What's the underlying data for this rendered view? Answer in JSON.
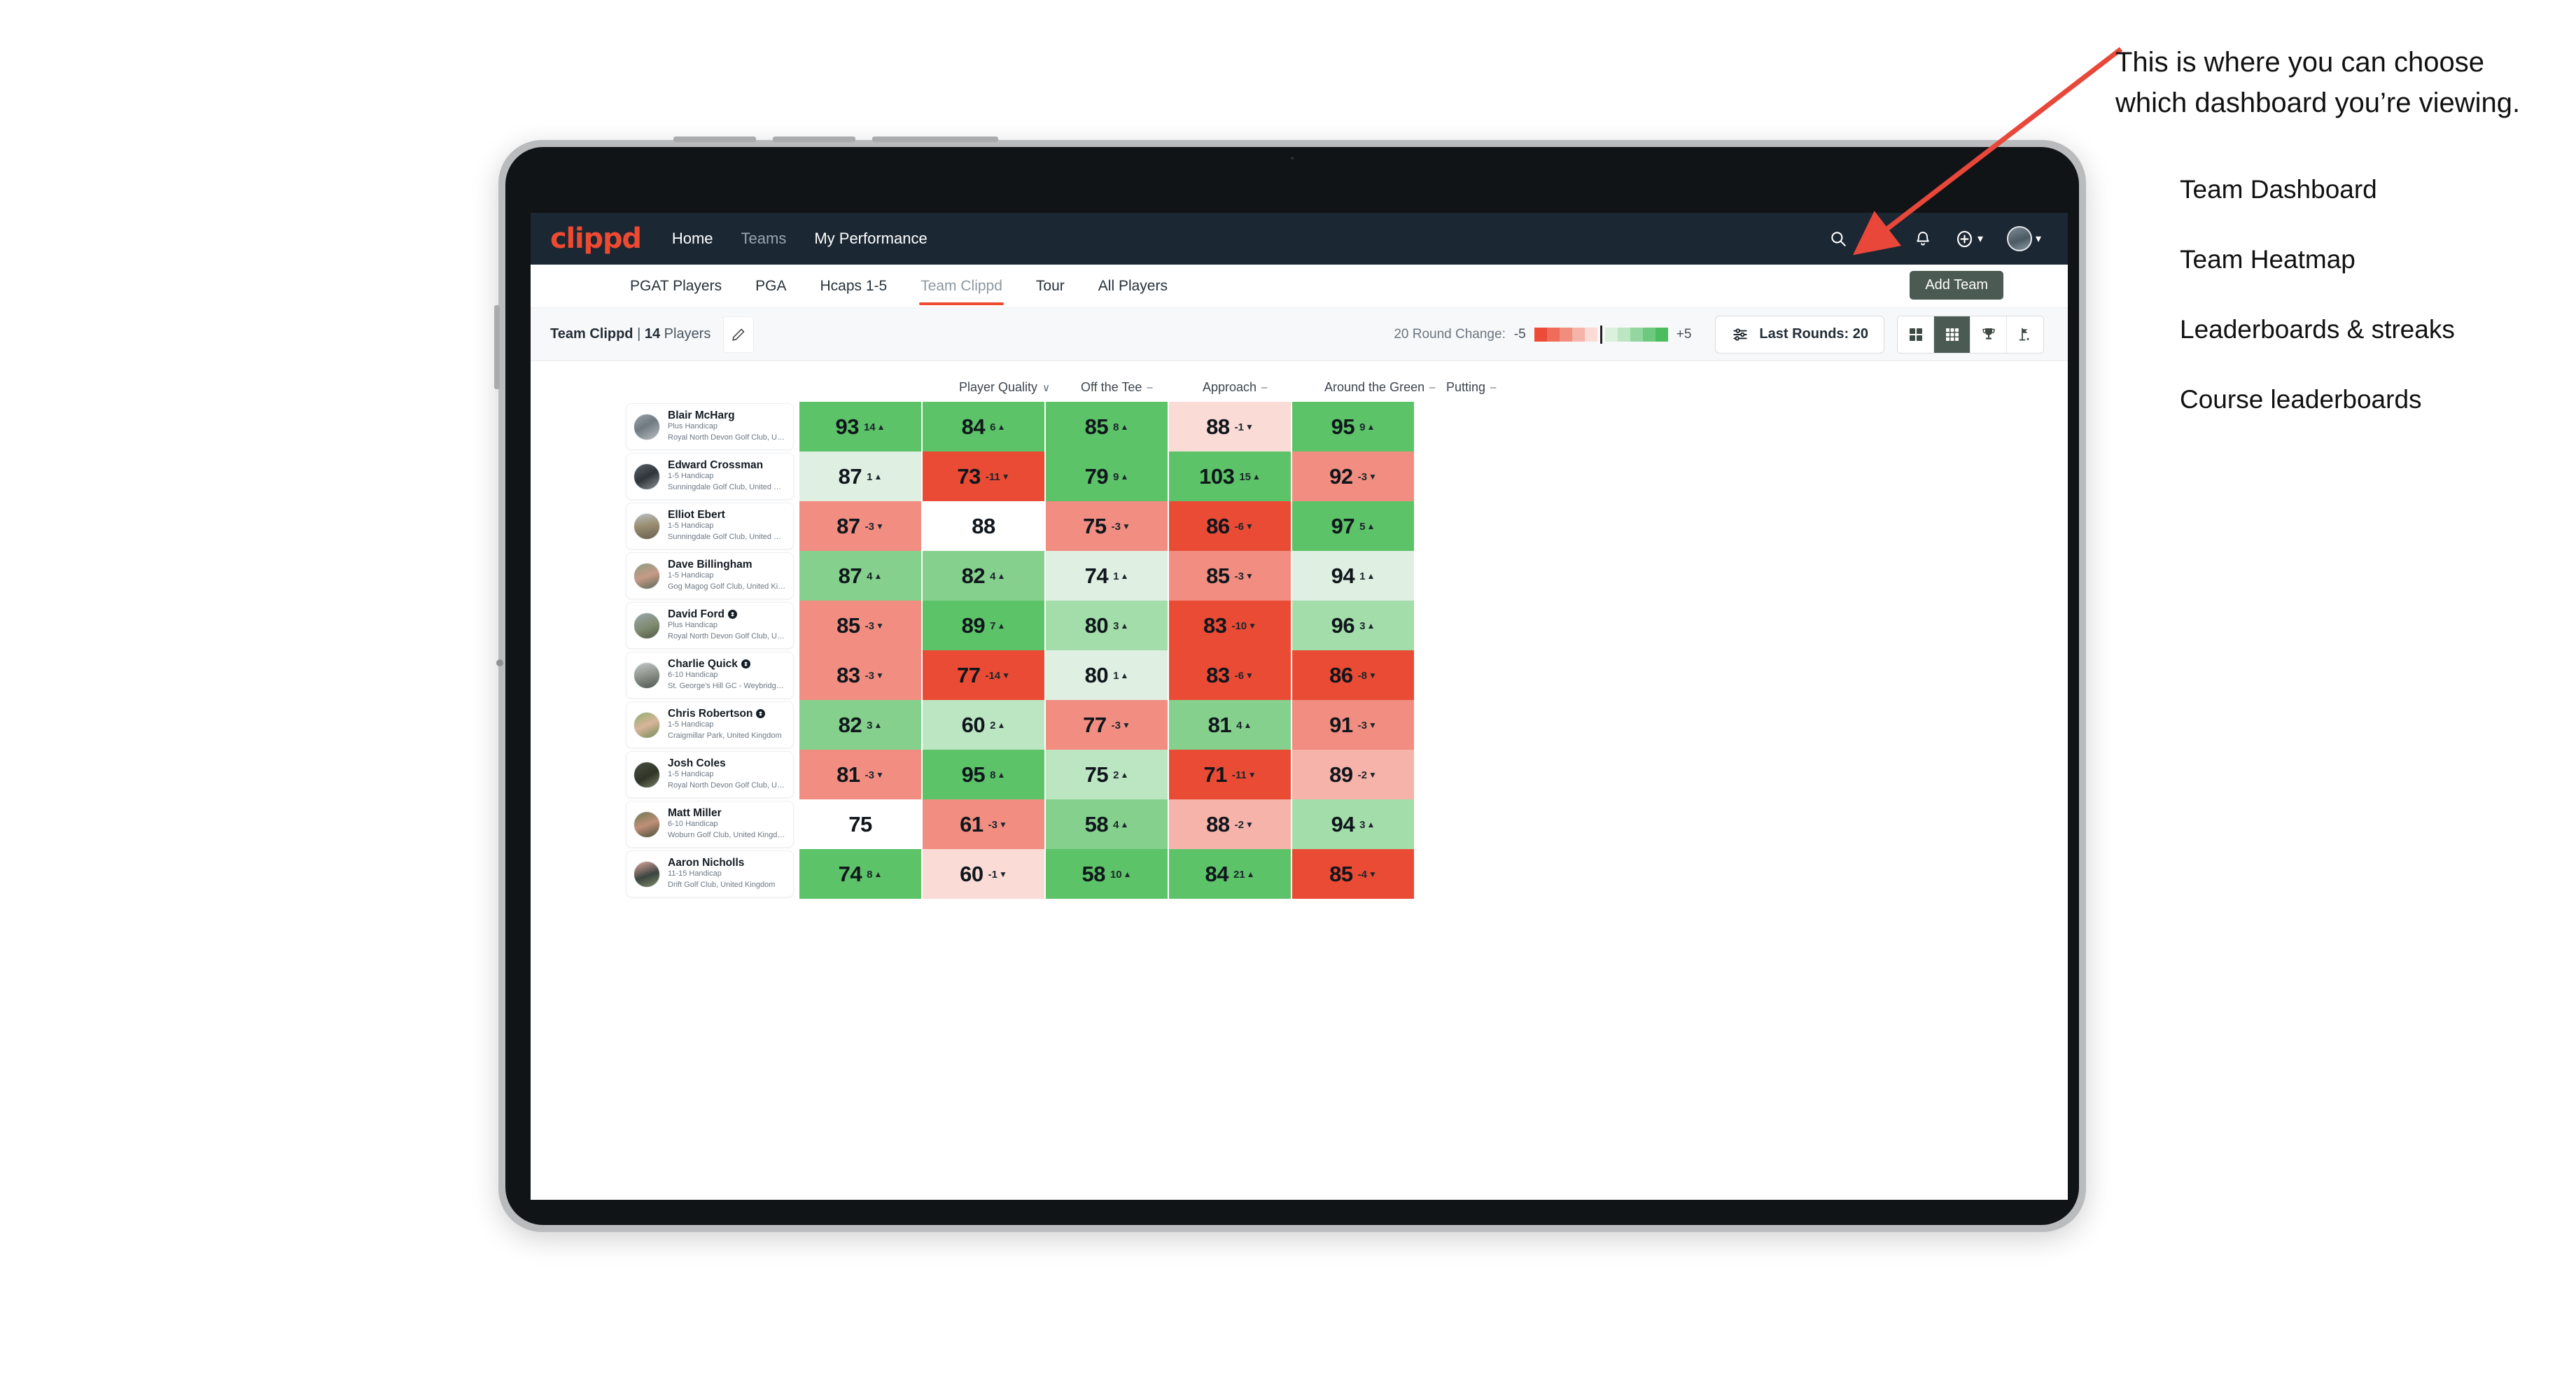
{
  "brand": {
    "logo_text": "clippd",
    "accent": "#ee4a31",
    "nav_bg": "#1b2733"
  },
  "topnav": {
    "links": [
      {
        "label": "Home",
        "active": true
      },
      {
        "label": "Teams",
        "active": false
      },
      {
        "label": "My Performance",
        "active": true
      }
    ],
    "icons": [
      "search-icon",
      "people-icon",
      "bell-icon",
      "plus-circle-icon",
      "avatar"
    ]
  },
  "subtabs": {
    "items": [
      {
        "label": "PGAT Players",
        "active": false
      },
      {
        "label": "PGA",
        "active": false
      },
      {
        "label": "Hcaps 1-5",
        "active": false
      },
      {
        "label": "Team Clippd",
        "active": true
      },
      {
        "label": "Tour",
        "active": false
      },
      {
        "label": "All Players",
        "active": false
      }
    ],
    "add_team_label": "Add Team"
  },
  "controls": {
    "team_name": "Team Clippd",
    "team_separator": " | ",
    "player_count": "14",
    "players_word": "Players",
    "edit_icon": "pencil-icon",
    "legend_title": "20 Round Change:",
    "legend_min": "-5",
    "legend_max": "+5",
    "legend_colors": [
      "#ec4b37",
      "#ef6c5a",
      "#f28c7d",
      "#f6b3aa",
      "#fadbd6",
      "#dcf0de",
      "#bce5c2",
      "#93d6a0",
      "#6dc97e",
      "#4cbd5f"
    ],
    "rounds_label": "Last Rounds: 20",
    "rounds_icon": "filter-sliders-icon",
    "view_toggles": [
      {
        "name": "team-dashboard",
        "icon": "four-squares-icon",
        "active": false
      },
      {
        "name": "team-heatmap",
        "icon": "grid-nine-icon",
        "active": true
      },
      {
        "name": "leaderboards-streaks",
        "icon": "trophy-icon",
        "active": false
      },
      {
        "name": "course-leaderboards",
        "icon": "golf-flag-icon",
        "active": false
      }
    ]
  },
  "table": {
    "columns": [
      {
        "label": "Player Quality",
        "marker": "∨"
      },
      {
        "label": "Off the Tee",
        "marker": "–"
      },
      {
        "label": "Approach",
        "marker": "–"
      },
      {
        "label": "Around the Green",
        "marker": "–"
      },
      {
        "label": "Putting",
        "marker": "–"
      }
    ],
    "rows": [
      {
        "name": "Blair McHarg",
        "verified": false,
        "handicap": "Plus Handicap",
        "club": "Royal North Devon Golf Club, United Kingdom",
        "photo": "linear-gradient(150deg,#9aa3a8 0%,#6f7a80 45%,#b9bfc3 100%)",
        "cells": [
          {
            "value": "93",
            "delta": "14",
            "dir": "up",
            "bg": "#5cc368"
          },
          {
            "value": "84",
            "delta": "6",
            "dir": "up",
            "bg": "#5cc368"
          },
          {
            "value": "85",
            "delta": "8",
            "dir": "up",
            "bg": "#5cc368"
          },
          {
            "value": "88",
            "delta": "-1",
            "dir": "down",
            "bg": "#fadbd6"
          },
          {
            "value": "95",
            "delta": "9",
            "dir": "up",
            "bg": "#5cc368"
          }
        ]
      },
      {
        "name": "Edward Crossman",
        "verified": false,
        "handicap": "1-5 Handicap",
        "club": "Sunningdale Golf Club, United Kingdom",
        "photo": "linear-gradient(150deg,#5c646a 0%,#2f3438 50%,#8d9498 100%)",
        "cells": [
          {
            "value": "87",
            "delta": "1",
            "dir": "up",
            "bg": "#dff0e2"
          },
          {
            "value": "73",
            "delta": "-11",
            "dir": "down",
            "bg": "#ea4b35"
          },
          {
            "value": "79",
            "delta": "9",
            "dir": "up",
            "bg": "#5cc368"
          },
          {
            "value": "103",
            "delta": "15",
            "dir": "up",
            "bg": "#5cc368"
          },
          {
            "value": "92",
            "delta": "-3",
            "dir": "down",
            "bg": "#f18e81"
          }
        ]
      },
      {
        "name": "Elliot Ebert",
        "verified": false,
        "handicap": "1-5 Handicap",
        "club": "Sunningdale Golf Club, United Kingdom",
        "photo": "linear-gradient(170deg,#b9bec2 0%,#9a8f72 45%,#6a6150 100%)",
        "cells": [
          {
            "value": "87",
            "delta": "-3",
            "dir": "down",
            "bg": "#f18e81"
          },
          {
            "value": "88",
            "delta": "",
            "dir": "",
            "bg": "#ffffff"
          },
          {
            "value": "75",
            "delta": "-3",
            "dir": "down",
            "bg": "#f18e81"
          },
          {
            "value": "86",
            "delta": "-6",
            "dir": "down",
            "bg": "#ea4b35"
          },
          {
            "value": "97",
            "delta": "5",
            "dir": "up",
            "bg": "#5cc368"
          }
        ]
      },
      {
        "name": "Dave Billingham",
        "verified": false,
        "handicap": "1-5 Handicap",
        "club": "Gog Magog Golf Club, United Kingdom",
        "photo": "linear-gradient(160deg,#8d9c7f 0%,#c69a86 50%,#5b6a58 100%)",
        "cells": [
          {
            "value": "87",
            "delta": "4",
            "dir": "up",
            "bg": "#84d08c"
          },
          {
            "value": "82",
            "delta": "4",
            "dir": "up",
            "bg": "#84d08c"
          },
          {
            "value": "74",
            "delta": "1",
            "dir": "up",
            "bg": "#dff0e2"
          },
          {
            "value": "85",
            "delta": "-3",
            "dir": "down",
            "bg": "#f18e81"
          },
          {
            "value": "94",
            "delta": "1",
            "dir": "up",
            "bg": "#dff0e2"
          }
        ]
      },
      {
        "name": "David Ford",
        "verified": true,
        "handicap": "Plus Handicap",
        "club": "Royal North Devon Golf Club, United Kingdom",
        "photo": "linear-gradient(160deg,#9aa6ac 0%,#7f8a6f 55%,#4f5a45 100%)",
        "cells": [
          {
            "value": "85",
            "delta": "-3",
            "dir": "down",
            "bg": "#f18e81"
          },
          {
            "value": "89",
            "delta": "7",
            "dir": "up",
            "bg": "#5cc368"
          },
          {
            "value": "80",
            "delta": "3",
            "dir": "up",
            "bg": "#a3deaa"
          },
          {
            "value": "83",
            "delta": "-10",
            "dir": "down",
            "bg": "#ea4b35"
          },
          {
            "value": "96",
            "delta": "3",
            "dir": "up",
            "bg": "#a3deaa"
          }
        ]
      },
      {
        "name": "Charlie Quick",
        "verified": true,
        "handicap": "6-10 Handicap",
        "club": "St. George's Hill GC - Weybridge - Surrey, Uni...",
        "photo": "linear-gradient(165deg,#c3c8cb 0%,#8b9189 50%,#4d5750 100%)",
        "cells": [
          {
            "value": "83",
            "delta": "-3",
            "dir": "down",
            "bg": "#f18e81"
          },
          {
            "value": "77",
            "delta": "-14",
            "dir": "down",
            "bg": "#ea4b35"
          },
          {
            "value": "80",
            "delta": "1",
            "dir": "up",
            "bg": "#dff0e2"
          },
          {
            "value": "83",
            "delta": "-6",
            "dir": "down",
            "bg": "#ea4b35"
          },
          {
            "value": "86",
            "delta": "-8",
            "dir": "down",
            "bg": "#ea4b35"
          }
        ]
      },
      {
        "name": "Chris Robertson",
        "verified": true,
        "handicap": "1-5 Handicap",
        "club": "Craigmillar Park, United Kingdom",
        "photo": "linear-gradient(155deg,#8fae6f 0%,#d8b49a 50%,#6d8c54 100%)",
        "cells": [
          {
            "value": "82",
            "delta": "3",
            "dir": "up",
            "bg": "#84d08c"
          },
          {
            "value": "60",
            "delta": "2",
            "dir": "up",
            "bg": "#bce5c2"
          },
          {
            "value": "77",
            "delta": "-3",
            "dir": "down",
            "bg": "#f18e81"
          },
          {
            "value": "81",
            "delta": "4",
            "dir": "up",
            "bg": "#84d08c"
          },
          {
            "value": "91",
            "delta": "-3",
            "dir": "down",
            "bg": "#f18e81"
          }
        ]
      },
      {
        "name": "Josh Coles",
        "verified": false,
        "handicap": "1-5 Handicap",
        "club": "Royal North Devon Golf Club, United Kingdom",
        "photo": "linear-gradient(150deg,#49503f 0%,#2f3428 55%,#7b8268 100%)",
        "cells": [
          {
            "value": "81",
            "delta": "-3",
            "dir": "down",
            "bg": "#f18e81"
          },
          {
            "value": "95",
            "delta": "8",
            "dir": "up",
            "bg": "#5cc368"
          },
          {
            "value": "75",
            "delta": "2",
            "dir": "up",
            "bg": "#bce5c2"
          },
          {
            "value": "71",
            "delta": "-11",
            "dir": "down",
            "bg": "#ea4b35"
          },
          {
            "value": "89",
            "delta": "-2",
            "dir": "down",
            "bg": "#f6b3aa"
          }
        ]
      },
      {
        "name": "Matt Miller",
        "verified": false,
        "handicap": "6-10 Handicap",
        "club": "Woburn Golf Club, United Kingdom",
        "photo": "linear-gradient(160deg,#6f7a54 0%,#c08e79 50%,#47503a 100%)",
        "cells": [
          {
            "value": "75",
            "delta": "",
            "dir": "",
            "bg": "#ffffff"
          },
          {
            "value": "61",
            "delta": "-3",
            "dir": "down",
            "bg": "#f18e81"
          },
          {
            "value": "58",
            "delta": "4",
            "dir": "up",
            "bg": "#84d08c"
          },
          {
            "value": "88",
            "delta": "-2",
            "dir": "down",
            "bg": "#f6b3aa"
          },
          {
            "value": "94",
            "delta": "3",
            "dir": "up",
            "bg": "#a3deaa"
          }
        ]
      },
      {
        "name": "Aaron Nicholls",
        "verified": false,
        "handicap": "11-15 Handicap",
        "club": "Drift Golf Club, United Kingdom",
        "photo": "linear-gradient(160deg,#e0a8a0 0%,#3c4440 55%,#7f8d6a 100%)",
        "cells": [
          {
            "value": "74",
            "delta": "8",
            "dir": "up",
            "bg": "#5cc368"
          },
          {
            "value": "60",
            "delta": "-1",
            "dir": "down",
            "bg": "#fadbd6"
          },
          {
            "value": "58",
            "delta": "10",
            "dir": "up",
            "bg": "#5cc368"
          },
          {
            "value": "84",
            "delta": "21",
            "dir": "up",
            "bg": "#5cc368"
          },
          {
            "value": "85",
            "delta": "-4",
            "dir": "down",
            "bg": "#ea4b35"
          }
        ]
      }
    ]
  },
  "annotation": {
    "callout": "This is where you can choose which dashboard you’re viewing.",
    "arrow_color": "#e8473a",
    "options": [
      "Team Dashboard",
      "Team Heatmap",
      "Leaderboards & streaks",
      "Course leaderboards"
    ]
  }
}
